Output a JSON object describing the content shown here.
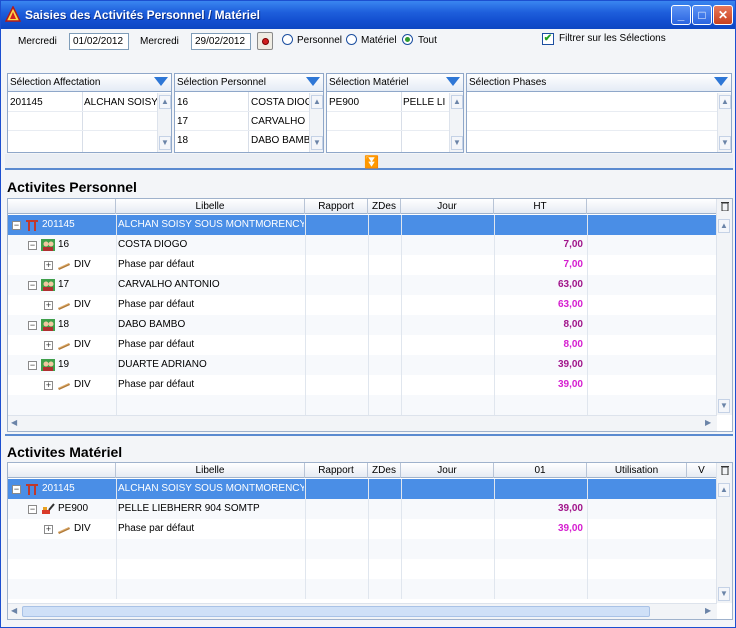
{
  "window": {
    "title": "Saisies des Activités Personnel / Matériel",
    "min_glyph": "_",
    "max_glyph": "□",
    "close_glyph": "✕"
  },
  "filters": {
    "day_from": "Mercredi",
    "date_from": "01/02/2012",
    "day_to": "Mercredi",
    "date_to": "29/02/2012",
    "radio_personnel": "Personnel",
    "radio_materiel": "Matériel",
    "radio_tout": "Tout",
    "radio_selected": "Tout",
    "filter_checkbox_label": "Filtrer sur les Sélections",
    "filter_checkbox_checked": true,
    "check_glyph": "✔"
  },
  "selections": {
    "affectation": {
      "title": "Sélection Affectation",
      "rows": [
        [
          "201145",
          "ALCHAN SOISY"
        ],
        [
          "",
          ""
        ],
        [
          "",
          ""
        ]
      ]
    },
    "personnel": {
      "title": "Sélection Personnel",
      "rows": [
        [
          "16",
          "COSTA DIOGO"
        ],
        [
          "17",
          "CARVALHO"
        ],
        [
          "18",
          "DABO BAMBO"
        ]
      ]
    },
    "materiel": {
      "title": "Sélection Matériel",
      "rows": [
        [
          "PE900",
          "PELLE LI"
        ],
        [
          "",
          ""
        ],
        [
          "",
          ""
        ]
      ]
    },
    "phases": {
      "title": "Sélection Phases",
      "rows": []
    },
    "scroll_up": "▲",
    "scroll_down": "▼",
    "collapse_glyph": "⏬"
  },
  "personnel_grid": {
    "title": "Activites Personnel",
    "headers": [
      "",
      "Libelle",
      "Rapport",
      "ZDes",
      "Jour",
      "HT"
    ],
    "rows": [
      {
        "level": 0,
        "code": "201145",
        "libelle": "ALCHAN SOISY SOUS MONTMORENCY",
        "value": "",
        "selected": true,
        "expander": "−",
        "icon": "site-icon"
      },
      {
        "level": 1,
        "code": "16",
        "libelle": "COSTA DIOGO",
        "value": "7,00",
        "selected": false,
        "expander": "−",
        "icon": "person-icon"
      },
      {
        "level": 2,
        "code": "DIV",
        "libelle": "Phase par défaut",
        "value": "7,00",
        "selected": false,
        "expander": "+",
        "icon": "phase-icon"
      },
      {
        "level": 1,
        "code": "17",
        "libelle": "CARVALHO ANTONIO",
        "value": "63,00",
        "selected": false,
        "expander": "−",
        "icon": "person-icon"
      },
      {
        "level": 2,
        "code": "DIV",
        "libelle": "Phase par défaut",
        "value": "63,00",
        "selected": false,
        "expander": "+",
        "icon": "phase-icon"
      },
      {
        "level": 1,
        "code": "18",
        "libelle": "DABO BAMBO",
        "value": "8,00",
        "selected": false,
        "expander": "−",
        "icon": "person-icon"
      },
      {
        "level": 2,
        "code": "DIV",
        "libelle": "Phase par défaut",
        "value": "8,00",
        "selected": false,
        "expander": "+",
        "icon": "phase-icon"
      },
      {
        "level": 1,
        "code": "19",
        "libelle": "DUARTE ADRIANO",
        "value": "39,00",
        "selected": false,
        "expander": "−",
        "icon": "person-icon"
      },
      {
        "level": 2,
        "code": "DIV",
        "libelle": "Phase par défaut",
        "value": "39,00",
        "selected": false,
        "expander": "+",
        "icon": "phase-icon"
      }
    ]
  },
  "materiel_grid": {
    "title": "Activites Matériel",
    "headers": [
      "",
      "Libelle",
      "Rapport",
      "ZDes",
      "Jour",
      "01",
      "Utilisation",
      "V"
    ],
    "rows": [
      {
        "level": 0,
        "code": "201145",
        "libelle": "ALCHAN SOISY SOUS MONTMORENCY",
        "value": "",
        "selected": true,
        "expander": "−",
        "icon": "site-icon"
      },
      {
        "level": 1,
        "code": "PE900",
        "libelle": "PELLE LIEBHERR 904 SOMTP",
        "value": "39,00",
        "selected": false,
        "expander": "−",
        "icon": "machine-icon"
      },
      {
        "level": 2,
        "code": "DIV",
        "libelle": "Phase par défaut",
        "value": "39,00",
        "selected": false,
        "expander": "+",
        "icon": "phase-icon"
      }
    ]
  },
  "colors": {
    "title_bar": "#1e5fdc",
    "selected_row": "#4a8ee6",
    "value_purple": "#a0148a",
    "value_pink": "#d51ed0"
  }
}
